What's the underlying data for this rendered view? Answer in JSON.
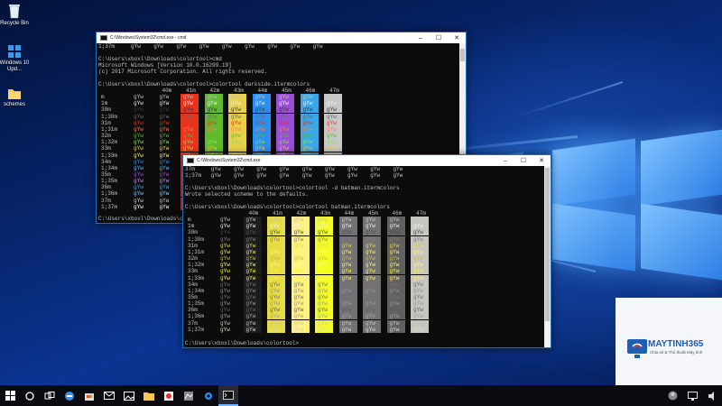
{
  "desktop": {
    "icons": [
      {
        "label": "Recycle Bin",
        "icon": "recycle-bin-icon"
      },
      {
        "label": "Windows 10 Upd...",
        "icon": "windows-update-icon"
      },
      {
        "label": "schemes",
        "icon": "folder-icon"
      }
    ]
  },
  "windows": [
    {
      "id": "darkside",
      "title": "C:\\Windows\\System32\\cmd.exe - cmd",
      "controls": [
        "–",
        "☐",
        "✕"
      ],
      "lines": [
        "1;37m     gYw    gYw    gYw    gYw    gYw    gYw    gYw    gYw    gYw",
        "",
        "C:\\Users\\xboxl\\Downloads\\colortool>cmd",
        "Microsoft Windows [Version 10.0.16299.19]",
        "(c) 2017 Microsoft Corporation. All rights reserved.",
        "",
        "C:\\Users\\xboxl\\Downloads\\colortool>colortool darkside.itermcolors"
      ],
      "grid_headers": [
        "40m",
        "41m",
        "42m",
        "43m",
        "44m",
        "45m",
        "46m",
        "47m"
      ],
      "row_labels": [
        "m",
        "1m",
        "30m",
        "1;30m",
        "31m",
        "1;31m",
        "32m",
        "1;32m",
        "33m",
        "1;33m",
        "34m",
        "1;34m",
        "35m",
        "1;35m",
        "36m",
        "1;36m",
        "37m",
        "1;37m"
      ],
      "bg_colors": [
        "#0c0c0c",
        "#e8341c",
        "#5fba2d",
        "#e8d04a",
        "#2a8ff0",
        "#9a4dd6",
        "#38a8e8",
        "#c8c8c8"
      ],
      "fg_colors": [
        "#c0c0c0",
        "#f0f0f0",
        "#3a3a3a",
        "#6a6a6a",
        "#e8341c",
        "#ff7a5a",
        "#5fba2d",
        "#8de060",
        "#e8d04a",
        "#fff08a",
        "#2a8ff0",
        "#6ab8ff",
        "#9a4dd6",
        "#c890ff",
        "#38a8e8",
        "#80d4ff",
        "#c8c8c8",
        "#ffffff"
      ],
      "sample": "gYw",
      "footer": "C:\\Users\\xboxl\\Downloads\\colortool>"
    },
    {
      "id": "batman",
      "title": "C:\\Windows\\System32\\cmd.exe",
      "controls": [
        "–",
        "☐",
        "✕"
      ],
      "lines": [
        "37m     gYw    gYw    gYw    gYw    gYw    gYw    gYw    gYw    gYw",
        "1;37m   gYw    gYw    gYw    gYw    gYw    gYw    gYw    gYw    gYw",
        "",
        "C:\\Users\\xboxl\\Downloads\\colortool>colortool -d batman.itermcolors",
        "Wrote selected scheme to the defaults.",
        "",
        "C:\\Users\\xboxl\\Downloads\\colortool>colortool batman.itermcolors"
      ],
      "grid_headers": [
        "40m",
        "41m",
        "42m",
        "43m",
        "44m",
        "45m",
        "46m",
        "47m"
      ],
      "row_labels": [
        "m",
        "1m",
        "30m",
        "1;30m",
        "31m",
        "1;31m",
        "32m",
        "1;32m",
        "33m",
        "1;33m",
        "34m",
        "1;34m",
        "35m",
        "1;35m",
        "36m",
        "1;36m",
        "37m",
        "1;37m"
      ],
      "bg_colors": [
        "#1b1d1e",
        "#e6dc44",
        "#fff27f",
        "#f3fd21",
        "#737174",
        "#747271",
        "#62605f",
        "#c6c5bf"
      ],
      "fg_colors": [
        "#c0c0c0",
        "#f0f0f0",
        "#505050",
        "#808080",
        "#e6dc44",
        "#fff27f",
        "#c8be46",
        "#fff78e",
        "#f3fd21",
        "#feed6c",
        "#737174",
        "#919495",
        "#747271",
        "#9a9a9d",
        "#62605f",
        "#a3a3a6",
        "#c6c5bf",
        "#dadbd6"
      ],
      "sample": "gYw",
      "footer": "C:\\Users\\xboxl\\Downloads\\colortool>"
    }
  ],
  "taskbar": {
    "icons": [
      "windows-start-icon",
      "cortana-circle-icon",
      "task-view-icon",
      "edge-browser-icon",
      "store-bag-icon",
      "mail-icon",
      "photos-icon",
      "file-explorer-icon",
      "paint-icon",
      "maps-icon",
      "settings-gear-icon",
      "cmd-console-icon"
    ],
    "tray": [
      "avatar-icon",
      "network-icon",
      "volume-icon"
    ]
  },
  "sponsor": {
    "name": "MAYTINH365",
    "tagline": "Chia sẻ & Thủ thuật Máy tính",
    "colors": {
      "primary": "#1e5fb4",
      "accent": "#e8342c"
    }
  }
}
